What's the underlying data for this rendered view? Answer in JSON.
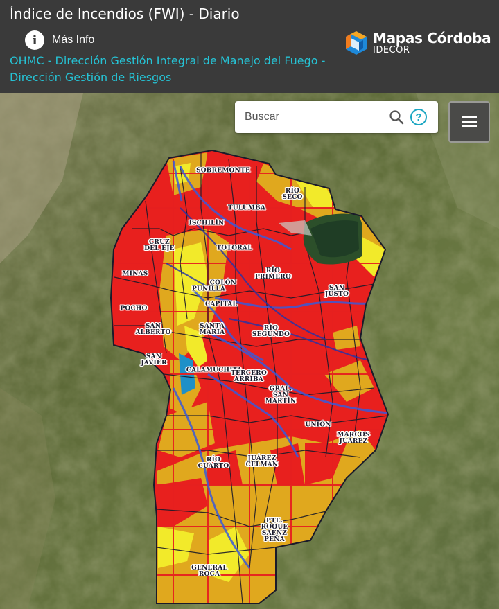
{
  "header": {
    "title": "Índice de Incendios (FWI) - Diario",
    "info_label": "Más Info",
    "source": "OHMC - Dirección Gestión Integral de Manejo del Fuego - Dirección Gestión de Riesgos",
    "brand_name": "Mapas Córdoba",
    "brand_sub": "IDECOR"
  },
  "search": {
    "placeholder": "Buscar"
  },
  "map": {
    "departments": [
      {
        "id": "sobremonte",
        "label": "SOBREMONTE"
      },
      {
        "id": "rio-seco",
        "label": "RÍO\nSECO"
      },
      {
        "id": "tulumba",
        "label": "TULUMBA"
      },
      {
        "id": "ischilin",
        "label": "ISCHILÍN"
      },
      {
        "id": "cruz-del-eje",
        "label": "CRUZ\nDEL EJE"
      },
      {
        "id": "totoral",
        "label": "TOTORAL"
      },
      {
        "id": "minas",
        "label": "MINAS"
      },
      {
        "id": "rio-primero",
        "label": "RÍO\nPRIMERO"
      },
      {
        "id": "colon",
        "label": "COLÓN"
      },
      {
        "id": "punilla",
        "label": "PUNILLA"
      },
      {
        "id": "san-justo",
        "label": "SAN\nJUSTO"
      },
      {
        "id": "pocho",
        "label": "POCHO"
      },
      {
        "id": "capital",
        "label": "CAPITAL"
      },
      {
        "id": "san-alberto",
        "label": "SAN\nALBERTO"
      },
      {
        "id": "santa-maria",
        "label": "SANTA\nMARÍA"
      },
      {
        "id": "rio-segundo",
        "label": "RÍO\nSEGUNDO"
      },
      {
        "id": "san-javier",
        "label": "SAN\nJAVIER"
      },
      {
        "id": "calamuchita",
        "label": "CALAMUCHITA"
      },
      {
        "id": "tercero-arriba",
        "label": "TERCERO\nARRIBA"
      },
      {
        "id": "gral-san-martin",
        "label": "GRAL.\nSAN\nMARTÍN"
      },
      {
        "id": "union",
        "label": "UNIÓN"
      },
      {
        "id": "marcos-juarez",
        "label": "MARCOS\nJUÁREZ"
      },
      {
        "id": "rio-cuarto",
        "label": "RÍO\nCUARTO"
      },
      {
        "id": "juarez-celman",
        "label": "JUÁREZ\nCELMAN"
      },
      {
        "id": "pte-roque-saenz-pena",
        "label": "PTE.\nROQUE\nSÁENZ\nPEÑA"
      },
      {
        "id": "general-roca",
        "label": "GENERAL\nROCA"
      }
    ],
    "legend_colors": {
      "extreme": "#e8201e",
      "high": "#e0a81e",
      "moderate": "#f2ea2a",
      "low": "#1e90c8"
    }
  }
}
